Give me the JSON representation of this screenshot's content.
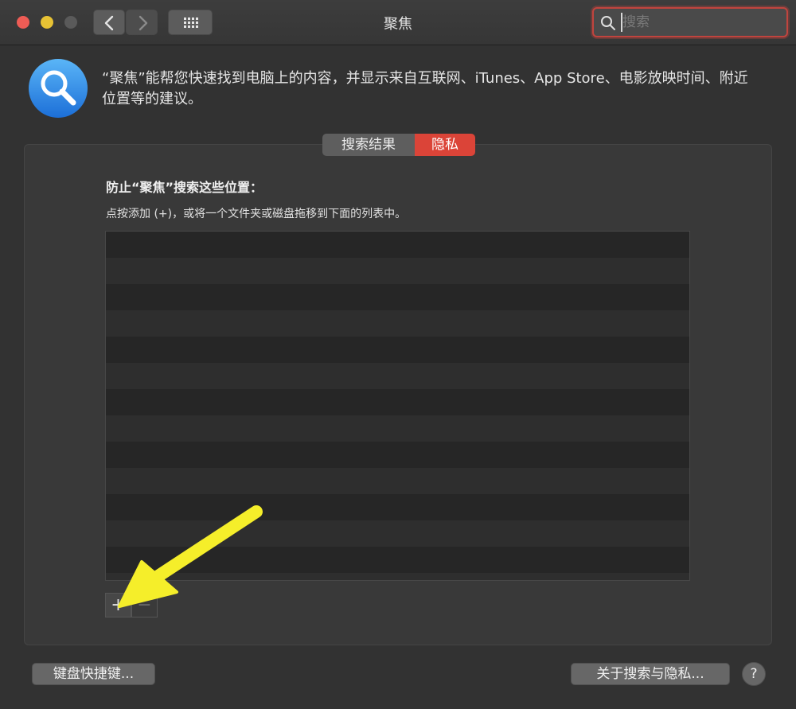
{
  "window": {
    "title": "聚焦"
  },
  "toolbar": {
    "back_icon": "chevron-left-icon",
    "forward_icon": "chevron-right-icon",
    "show_all_icon": "grid-icon"
  },
  "search": {
    "placeholder": "搜索",
    "value": ""
  },
  "header": {
    "icon": "spotlight-magnifier-icon",
    "description": "“聚焦”能帮您快速找到电脑上的内容，并显示来自互联网、iTunes、App Store、电影放映时间、附近位置等的建议。"
  },
  "tabs": [
    {
      "label": "搜索结果",
      "selected": false
    },
    {
      "label": "隐私",
      "selected": true
    }
  ],
  "privacy": {
    "heading": "防止“聚焦”搜索这些位置：",
    "hint": "点按添加 (+)，或将一个文件夹或磁盘拖移到下面的列表中。",
    "excluded_locations": [],
    "add_label": "+",
    "remove_label": "−"
  },
  "footer": {
    "keyboard_shortcuts_label": "键盘快捷键...",
    "about_label": "关于搜索与隐私...",
    "help_label": "?"
  },
  "colors": {
    "accent_red": "#db4438",
    "annotation_arrow": "#f5ee2a"
  }
}
